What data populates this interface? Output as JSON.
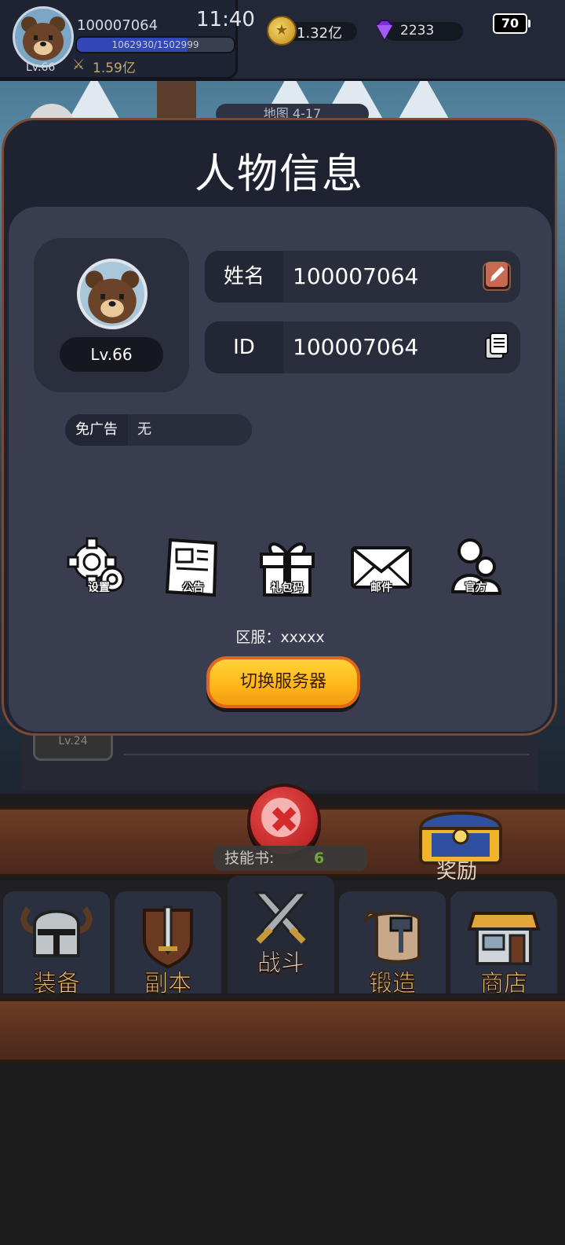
{
  "hud": {
    "player_name": "100007064",
    "exp_text": "1062930/1502999",
    "exp_fraction": 0.707,
    "level": "Lv.66",
    "power": "1.59亿",
    "time": "11:40",
    "coins": "1.32亿",
    "gems": "2233",
    "battery": "70",
    "map_peek": "地图 4-17"
  },
  "modal": {
    "title": "人物信息",
    "level_badge": "Lv.66",
    "name_label": "姓名",
    "name_value": "100007064",
    "id_label": "ID",
    "id_value": "100007064",
    "noad_label": "免广告",
    "noad_value": "无",
    "menu": [
      {
        "label": "设置",
        "icon": "gear-icon"
      },
      {
        "label": "公告",
        "icon": "notice-icon"
      },
      {
        "label": "礼包码",
        "icon": "gift-icon"
      },
      {
        "label": "邮件",
        "icon": "mail-icon"
      },
      {
        "label": "官方",
        "icon": "official-icon"
      }
    ],
    "server_text": "区服：xxxxx",
    "switch_button": "切换服务器"
  },
  "list_peek": {
    "level_badge": "Lv.24"
  },
  "bottom": {
    "close_icon": "close-icon",
    "skill_label": "技能书:",
    "skill_count": "6",
    "reward_label": "奖励"
  },
  "nav": [
    {
      "label": "装备",
      "icon": "helmet-icon"
    },
    {
      "label": "副本",
      "icon": "sword-shield-icon"
    },
    {
      "label": "战斗",
      "icon": "crossed-swords-icon"
    },
    {
      "label": "锻造",
      "icon": "scroll-hammer-icon"
    },
    {
      "label": "商店",
      "icon": "shop-icon"
    }
  ],
  "colors": {
    "accent_orange": "#ffb81a",
    "modal_border": "#7a4a35",
    "exp_bar": "#3347b8",
    "skill_count": "#79b13e"
  }
}
